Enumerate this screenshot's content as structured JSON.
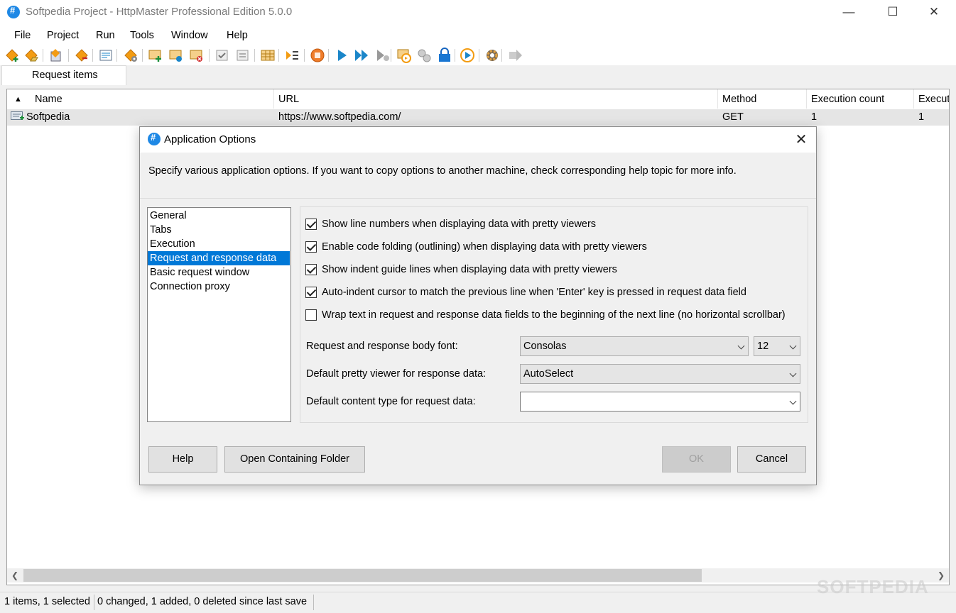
{
  "window": {
    "title": "Softpedia Project - HttpMaster Professional Edition 5.0.0",
    "minimize": "—",
    "maximize": "☐",
    "close": "✕"
  },
  "menu": [
    "File",
    "Project",
    "Run",
    "Tools",
    "Window",
    "Help"
  ],
  "toolbar": {
    "icons": [
      "add-project-icon",
      "open-project-icon",
      "save-project-icon",
      "export-icon",
      "import-icon",
      "project-settings-icon",
      "add-request-icon",
      "edit-request-icon",
      "delete-request-icon",
      "check-icon",
      "uncheck-icon",
      "grid-icon",
      "play-list-icon",
      "stop-icon",
      "run-icon",
      "run-all-icon",
      "run-to-icon",
      "run-schedule-icon",
      "link-icon",
      "lock-icon",
      "record-icon",
      "settings-icon",
      "forward-icon"
    ],
    "accent_orange": "#f39c12",
    "accent_blue": "#1b86c9"
  },
  "tabs": [
    "Request items"
  ],
  "list": {
    "columns": [
      "Name",
      "URL",
      "Method",
      "Execution count",
      "Execut"
    ],
    "rows": [
      {
        "name": "Softpedia",
        "url": "https://www.softpedia.com/",
        "method": "GET",
        "exec_count": "1",
        "exec2": "1"
      }
    ]
  },
  "status": {
    "items": "1 items, 1 selected",
    "changes": "0 changed, 1 added, 0 deleted since last save",
    "watermark": "SOFTPEDIA"
  },
  "dialog": {
    "title": "Application Options",
    "description": "Specify various application options. If you want to copy options to another machine, check corresponding help topic for more info.",
    "categories": [
      "General",
      "Tabs",
      "Execution",
      "Request and response data",
      "Basic request window",
      "Connection proxy"
    ],
    "selected_category": "Request and response data",
    "options": [
      {
        "label": "Show line numbers when displaying data with pretty viewers",
        "checked": true
      },
      {
        "label": "Enable code folding (outlining) when displaying data with pretty viewers",
        "checked": true
      },
      {
        "label": "Show indent guide lines when displaying data with pretty viewers",
        "checked": true
      },
      {
        "label": "Auto-indent cursor to match the previous line when 'Enter' key is pressed in request data field",
        "checked": true
      },
      {
        "label": "Wrap text in request and response data fields to the beginning of the next line (no horizontal scrollbar)",
        "checked": false
      }
    ],
    "fields": {
      "body_font_label": "Request and response body font:",
      "body_font_value": "Consolas",
      "body_font_size": "12",
      "pretty_viewer_label": "Default pretty viewer for response data:",
      "pretty_viewer_value": "AutoSelect",
      "content_type_label": "Default content type for request data:",
      "content_type_value": ""
    },
    "buttons": {
      "help": "Help",
      "open_folder": "Open Containing Folder",
      "ok": "OK",
      "cancel": "Cancel"
    },
    "selection_color": "#0078d7"
  }
}
